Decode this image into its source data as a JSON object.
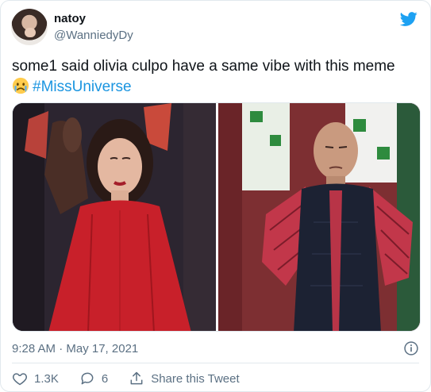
{
  "author": {
    "display_name": "natoy",
    "handle": "@WanniedyDy"
  },
  "tweet": {
    "text": "some1 said olivia culpo have a same vibe with this meme",
    "hashtag": "#MissUniverse",
    "emoji": "crying-face-emoji",
    "timestamp": "9:28 AM · May 17, 2021"
  },
  "media": [
    {
      "description_icon": "photo-woman-red-dress"
    },
    {
      "description_icon": "photo-man-arms-akimbo"
    }
  ],
  "actions": {
    "likes": "1.3K",
    "replies": "6",
    "share_label": "Share this Tweet"
  },
  "icons": {
    "brand": "twitter-bird-icon",
    "info": "info-icon",
    "like": "heart-icon",
    "reply": "reply-icon",
    "share": "share-icon"
  },
  "colors": {
    "brand_blue": "#1da1f2",
    "hashtag": "#1b95e0",
    "muted": "#5b7083"
  }
}
